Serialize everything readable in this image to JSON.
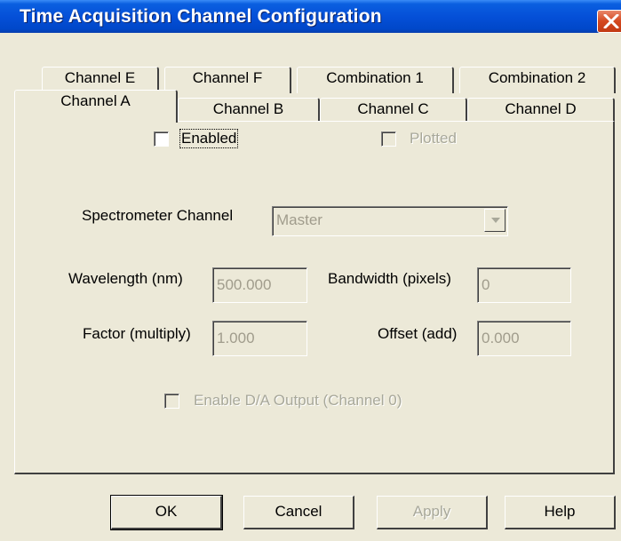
{
  "window": {
    "title": "Time Acquisition Channel Configuration"
  },
  "tabs": {
    "back_row": [
      "Channel E",
      "Channel F",
      "Combination 1",
      "Combination 2"
    ],
    "front_row": [
      "Channel A",
      "Channel B",
      "Channel C",
      "Channel D"
    ],
    "active": "Channel A"
  },
  "form": {
    "enabled_label": "Enabled",
    "enabled_checked": false,
    "plotted_label": "Plotted",
    "plotted_checked": false,
    "spectrometer_label": "Spectrometer Channel",
    "spectrometer_value": "Master",
    "wavelength_label": "Wavelength (nm)",
    "wavelength_value": "500.000",
    "bandwidth_label": "Bandwidth (pixels)",
    "bandwidth_value": "0",
    "factor_label": "Factor (multiply)",
    "factor_value": "1.000",
    "offset_label": "Offset (add)",
    "offset_value": "0.000",
    "da_output_label": "Enable D/A Output (Channel 0)",
    "da_output_checked": false
  },
  "buttons": {
    "ok": "OK",
    "cancel": "Cancel",
    "apply": "Apply",
    "help": "Help"
  },
  "colors": {
    "titlebar": "#0550d8",
    "dialog": "#ece9d8",
    "close": "#d4481f"
  },
  "icons": {
    "close": "close-icon",
    "dropdown": "chevron-down-icon"
  }
}
